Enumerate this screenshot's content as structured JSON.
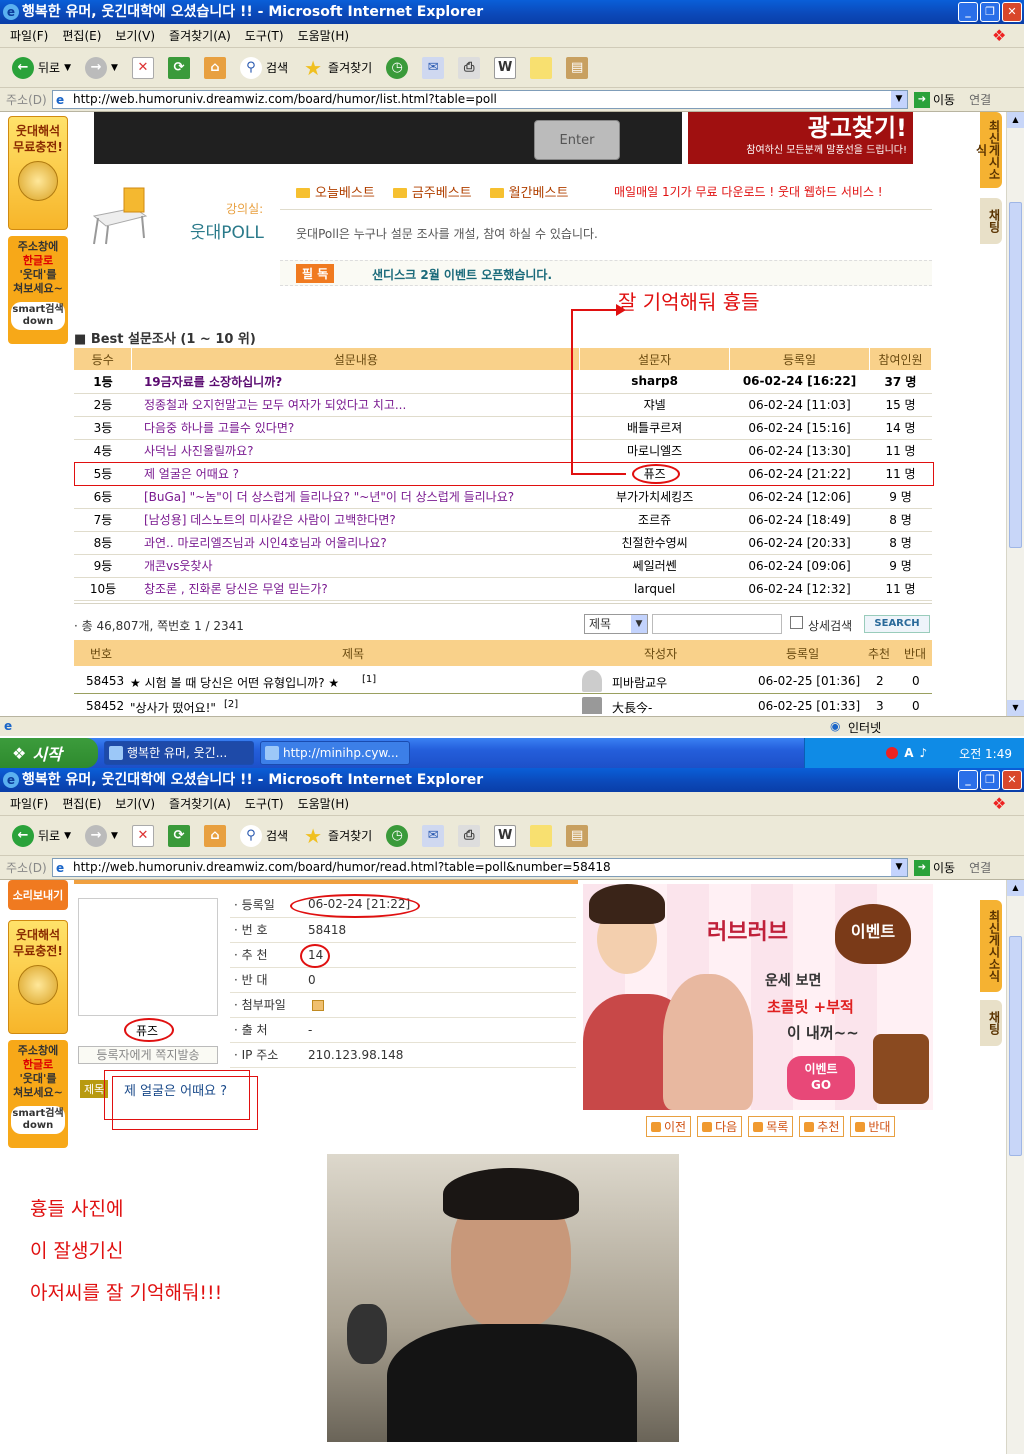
{
  "window1": {
    "title": "행복한 유머, 웃긴대학에 오셨습니다 !! - Microsoft Internet Explorer",
    "menu": [
      "파일(F)",
      "편집(E)",
      "보기(V)",
      "즐겨찾기(A)",
      "도구(T)",
      "도움말(H)"
    ],
    "toolbar": {
      "back": "뒤로",
      "search": "검색",
      "favorites": "즐겨찾기"
    },
    "address_label": "주소(D)",
    "url": "http://web.humoruniv.dreamwiz.com/board/humor/list.html?table=poll",
    "go": "이동",
    "links": "연결",
    "banner_ad": "광고찾기!",
    "banner_ad_sub": "참여하신 모든분께 말풍선을 드립니다!",
    "enter_key": "Enter",
    "lecture_label": "강의실:",
    "board_name": "웃대POLL",
    "tabs": [
      "오늘베스트",
      "금주베스트",
      "월간베스트"
    ],
    "promo": "매일매일 1기가 무료 다운로드 ! 웃대 웹하드 서비스 !",
    "desc": "웃대Poll은 누구나 설문 조사를 개설, 참여 하실 수 있습니다.",
    "notice_badge": "필 독",
    "notice": "샌디스크 2월 이벤트 오픈했습니다.",
    "side_ad1": "웃대해석\n무료충전!",
    "side_ad2": [
      "주소창에",
      "한글로",
      "'웃대'를",
      "쳐보세요~"
    ],
    "side_ad2_logo": "smart검색\ndown",
    "right_tab1": "최신게시소식",
    "right_tab2": "채팅",
    "annotation": "잘 기억해둬 흉들",
    "best_title": "Best 설문조사 (1 ~ 10 위)",
    "best_headers": [
      "등수",
      "설문내용",
      "설문자",
      "등록일",
      "참여인원"
    ],
    "best_rows": [
      [
        "1등",
        "19금자료를 소장하십니까?",
        "sharp8",
        "06-02-24 [16:22]",
        "37 명"
      ],
      [
        "2등",
        "정종철과 오지헌말고는 모두 여자가 되었다고 치고...",
        "쟈넬",
        "06-02-24 [11:03]",
        "15 명"
      ],
      [
        "3등",
        "다음중 하나를 고를수 있다면?",
        "배틀쿠르져",
        "06-02-24 [15:16]",
        "14 명"
      ],
      [
        "4등",
        "사덕님 사진올릴까요?",
        "마로니엘즈",
        "06-02-24 [13:30]",
        "11 명"
      ],
      [
        "5등",
        "제 얼굴은 어때요 ?",
        "퓨즈",
        "06-02-24 [21:22]",
        "11 명"
      ],
      [
        "6등",
        "[BuGa] \"~놈\"이 더 상스럽게 들리나요? \"~년\"이 더 상스럽게 들리나요?",
        "부가가치세킹즈",
        "06-02-24 [12:06]",
        "9 명"
      ],
      [
        "7등",
        "[남성용] 데스노트의 미사같은 사람이 고백한다면?",
        "조르쥬",
        "06-02-24 [18:49]",
        "8 명"
      ],
      [
        "8등",
        "과연.. 마로리엘즈님과 시인4호님과 어울리나요?",
        "친절한수영씨",
        "06-02-24 [20:33]",
        "8 명"
      ],
      [
        "9등",
        "개콘vs웃찾사",
        "쎄일러쎈",
        "06-02-24 [09:06]",
        "9 명"
      ],
      [
        "10등",
        "창조론 , 진화론 당신은 무얼 믿는가?",
        "larquel",
        "06-02-24 [12:32]",
        "11 명"
      ]
    ],
    "total": "· 총 46,807개, 쪽번호 1 / 2341",
    "search_select": "제목",
    "detail_search": "상세검색",
    "search_btn": "SEARCH",
    "list_headers": [
      "번호",
      "제목",
      "작성자",
      "등록일",
      "추천",
      "반대"
    ],
    "list_rows": [
      [
        "58453",
        "★ 시험 볼 때 당신은 어떤 유형입니까? ★",
        "[1]",
        "피바람교우",
        "06-02-25 [01:36]",
        "2",
        "0"
      ],
      [
        "58452",
        "\"상사가 떴어요!\"",
        "[2]",
        "大長今-",
        "06-02-25 [01:33]",
        "3",
        "0"
      ]
    ],
    "status": "인터넷"
  },
  "taskbar": {
    "start": "시작",
    "tasks": [
      "행복한 유머, 웃긴...",
      "http://minihp.cyw..."
    ],
    "clock": "오전 1:49"
  },
  "window2": {
    "title": "행복한 유머, 웃긴대학에 오셨습니다 !! - Microsoft Internet Explorer",
    "url": "http://web.humoruniv.dreamwiz.com/board/humor/read.html?table=poll&number=58418",
    "side_ad0": "소리보내기",
    "author": "퓨즈",
    "send_msg": "등록자에게 쪽지발송",
    "info": [
      [
        "· 등록일",
        "06-02-24 [21:22]"
      ],
      [
        "· 번 호",
        "58418"
      ],
      [
        "· 추 천",
        "14"
      ],
      [
        "· 반 대",
        "0"
      ],
      [
        "· 첨부파일",
        ""
      ],
      [
        "· 출 처",
        "-"
      ],
      [
        "· IP 주소",
        "210.123.98.148"
      ]
    ],
    "subject_label": "제목",
    "subject": "제 얼굴은 어때요 ?",
    "ad_title": "러브러브",
    "ad_event": "이벤트",
    "ad_lines": [
      "운세 보면",
      "초콜릿 +부적",
      "이 내꺼~~"
    ],
    "ad_btn": "이벤트\nGO",
    "nav": [
      "이전",
      "다음",
      "목록",
      "추천",
      "반대"
    ],
    "caption": [
      "흉들 사진에",
      "이 잘생기신",
      "아저씨를 잘 기억해둬!!!"
    ]
  },
  "colors": {
    "accent": "#f9d18a",
    "annotation": "#e01010",
    "title_bar": "#0b48b8"
  }
}
